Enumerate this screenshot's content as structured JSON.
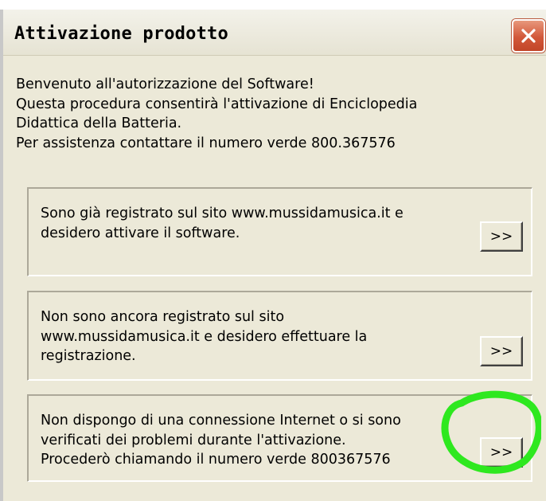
{
  "window": {
    "title": "Attivazione prodotto",
    "close_icon": "close-x-icon"
  },
  "intro": {
    "lines": [
      "Benvenuto all'autorizzazione del Software!",
      "Questa procedura consentirà l'attivazione di Enciclopedia",
      "Didattica della Batteria.",
      "Per assistenza contattare il numero verde 800.367576"
    ]
  },
  "options": [
    {
      "lines": [
        "Sono già registrato sul sito www.mussidamusica.it e",
        "desidero attivare il software."
      ],
      "button_label": ">>"
    },
    {
      "lines": [
        "Non sono ancora registrato sul sito",
        "www.mussidamusica.it e desidero effettuare la",
        "registrazione."
      ],
      "button_label": ">>"
    },
    {
      "lines": [
        "Non dispongo di una connessione Internet o si sono",
        "verificati dei problemi durante l'attivazione.",
        "Procederò chiamando il numero verde 800367576"
      ],
      "button_label": ">>"
    }
  ],
  "colors": {
    "dialog_background": "#ece9d8",
    "close_button": "#d2583a",
    "highlight_circle": "#2ee81f"
  }
}
